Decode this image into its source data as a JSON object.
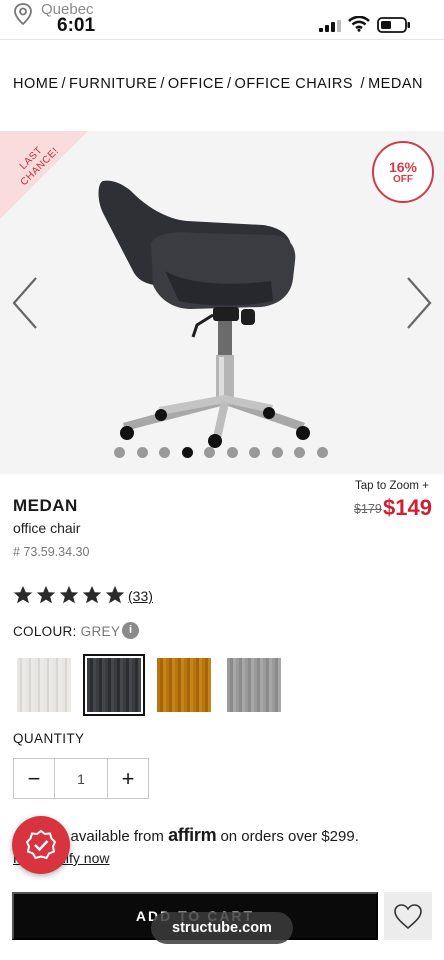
{
  "status_bar": {
    "location": "Quebec",
    "time": "6:01"
  },
  "breadcrumb": [
    "HOME",
    "FURNITURE",
    "OFFICE",
    "OFFICE CHAIRS",
    "MEDAN"
  ],
  "gallery": {
    "ribbon": "LAST CHANCE!",
    "badge_pct": "16%",
    "badge_off": "OFF",
    "image_count": 10,
    "active_image": 4,
    "zoom_label": "Tap to Zoom +"
  },
  "product": {
    "name": "MEDAN",
    "subtitle": "office chair",
    "sku": "# 73.59.34.30",
    "price_old": "$179",
    "price_new": "$149",
    "rating": 5,
    "reviews": "(33)"
  },
  "colour": {
    "label": "COLOUR:",
    "value": "GREY",
    "info": "i",
    "swatches": [
      "white",
      "grey",
      "orange",
      "light-grey"
    ],
    "selected": 1
  },
  "quantity": {
    "label": "QUANTITY",
    "minus": "−",
    "value": "1",
    "plus": "+"
  },
  "financing": {
    "text_start": "g available from",
    "brand": "affirm",
    "text_end": "on orders over $299.",
    "link": "Pre-qualify now"
  },
  "actions": {
    "add_to_cart": "ADD TO CART",
    "url": "structube.com"
  },
  "colors": {
    "accent": "#cf1f30",
    "badge": "#d23c4a",
    "button": "#0a0a0a"
  }
}
